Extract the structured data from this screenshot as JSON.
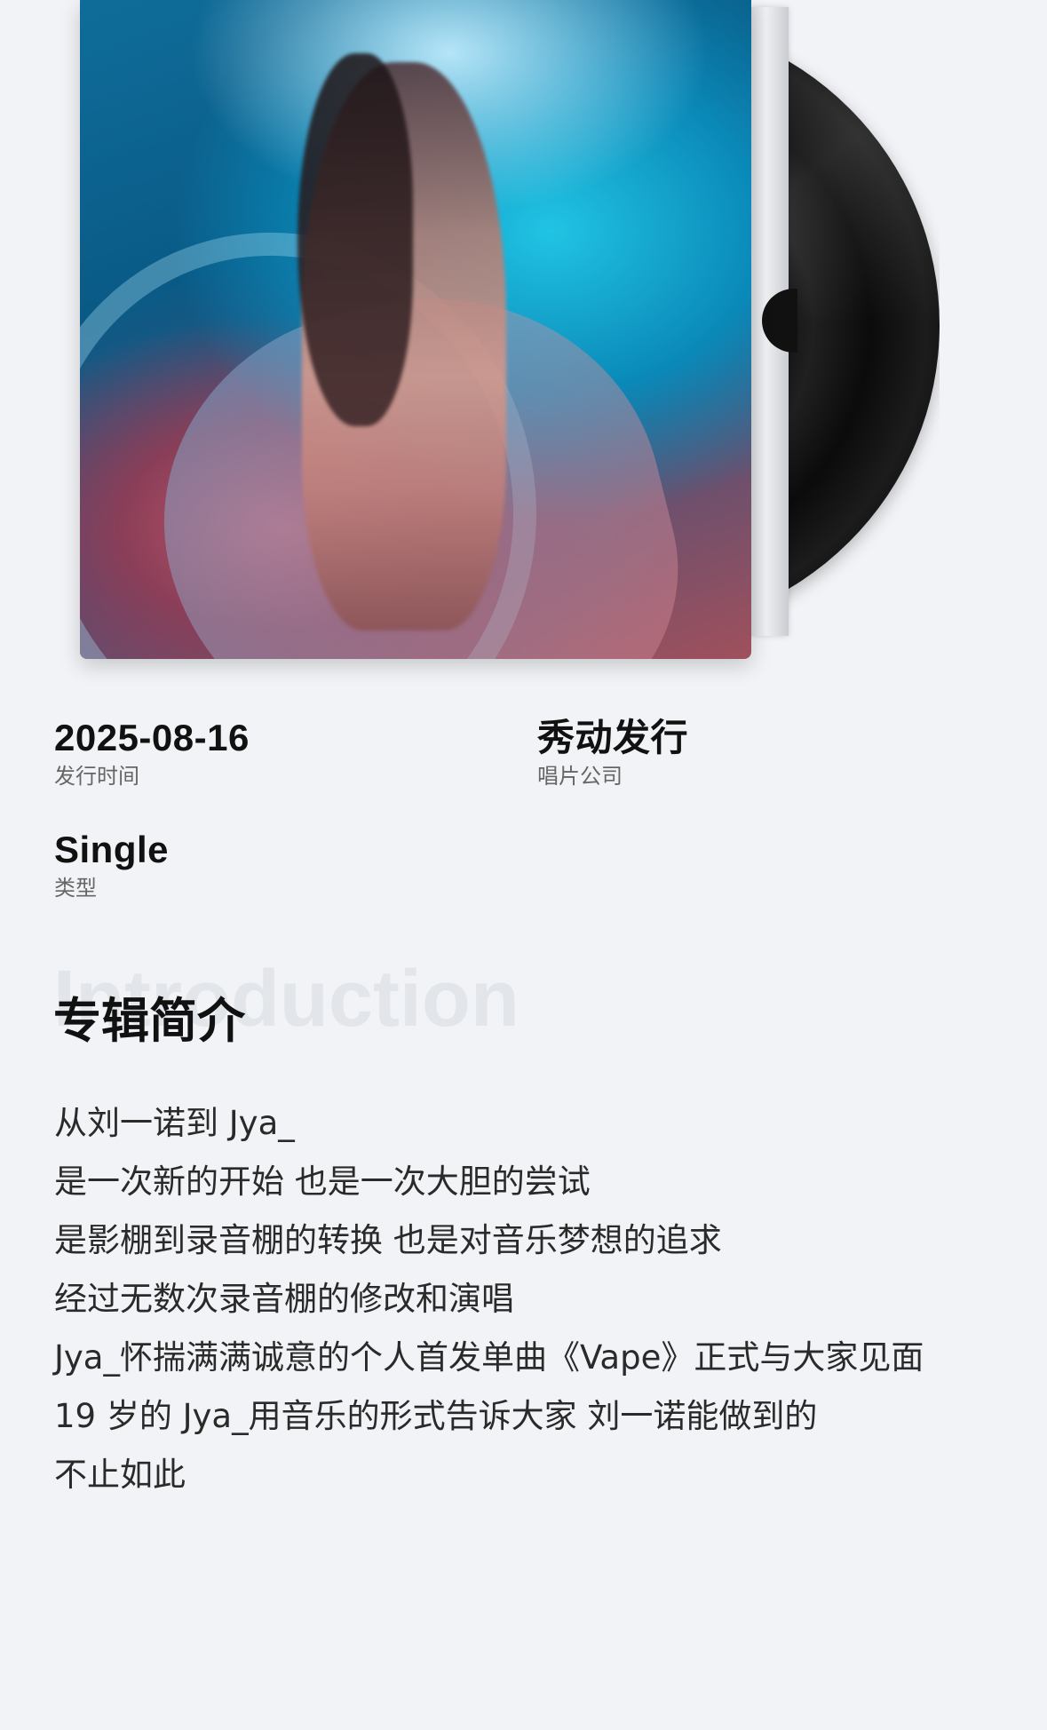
{
  "album": {
    "cover_alt": "album cover"
  },
  "meta": {
    "release_date": "2025-08-16",
    "release_date_label": "发行时间",
    "label": "秀动发行",
    "label_label": "唱片公司",
    "type": "Single",
    "type_label": "类型"
  },
  "intro": {
    "watermark": "Introduction",
    "title": "专辑简介",
    "lines": [
      "从刘一诺到 Jya_",
      "是一次新的开始 也是一次大胆的尝试",
      "是影棚到录音棚的转换 也是对音乐梦想的追求",
      "经过无数次录音棚的修改和演唱",
      "Jya_怀揣满满诚意的个人首发单曲《Vape》正式与大家见面",
      "19 岁的 Jya_用音乐的形式告诉大家 刘一诺能做到的",
      "不止如此"
    ]
  },
  "colors": {
    "background": "#f1f3f6",
    "text_primary": "#111111",
    "text_secondary": "#666666",
    "watermark": "#e2e5e9"
  }
}
